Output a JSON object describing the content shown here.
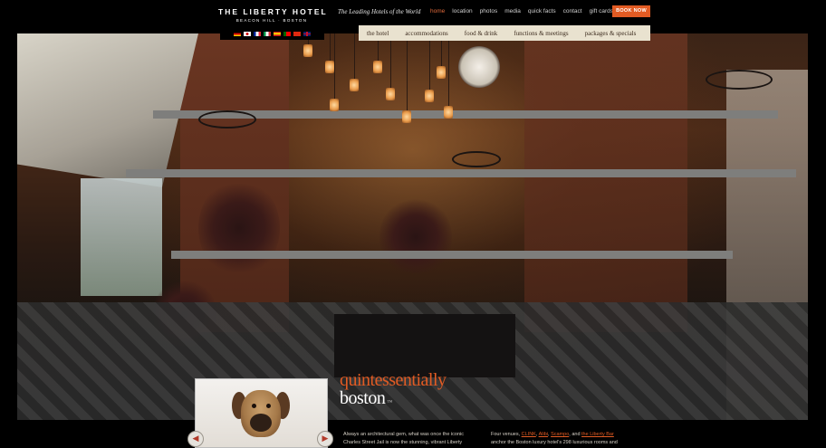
{
  "brand": {
    "name": "THE LIBERTY HOTEL",
    "location": "BEACON HILL · BOSTON",
    "affiliation": "The Leading Hotels of the World"
  },
  "topnav": {
    "items": [
      "home",
      "location",
      "photos",
      "media",
      "quick facts",
      "contact",
      "gift cards"
    ],
    "active_index": 0,
    "book_label": "BOOK NOW"
  },
  "languages": [
    "german-flag",
    "japanese-flag",
    "french-flag",
    "italian-flag",
    "spanish-flag",
    "portuguese-flag",
    "chinese-flag",
    "english-flag"
  ],
  "subnav": {
    "items": [
      "the hotel",
      "accommodations",
      "food & drink",
      "functions & meetings",
      "packages & specials"
    ]
  },
  "headline": {
    "line1": "quintessentially",
    "line2": "boston",
    "mark": "™"
  },
  "carousel": {
    "prev_icon": "chevron-left-icon",
    "next_icon": "chevron-right-icon",
    "prev_glyph": "◀",
    "next_glyph": "▶"
  },
  "intro": {
    "col1_line1": "Always an architectural gem, what was once the iconic",
    "col1_line2": "Charles Street Jail is now the stunning, vibrant Liberty",
    "col2_prefix": "Four venues, ",
    "venues": [
      "CLINK",
      "Alibi",
      "Scampo",
      "the Liberty Bar"
    ],
    "sep1": ", ",
    "sep2": ", ",
    "sep3": ", and ",
    "col2_line2": "anchor the Boston luxury hotel's 298 luxurious rooms and"
  },
  "colors": {
    "accent": "#e25b23",
    "subnav_bg": "#e9e2cf",
    "active_nav": "#e06a3b"
  }
}
